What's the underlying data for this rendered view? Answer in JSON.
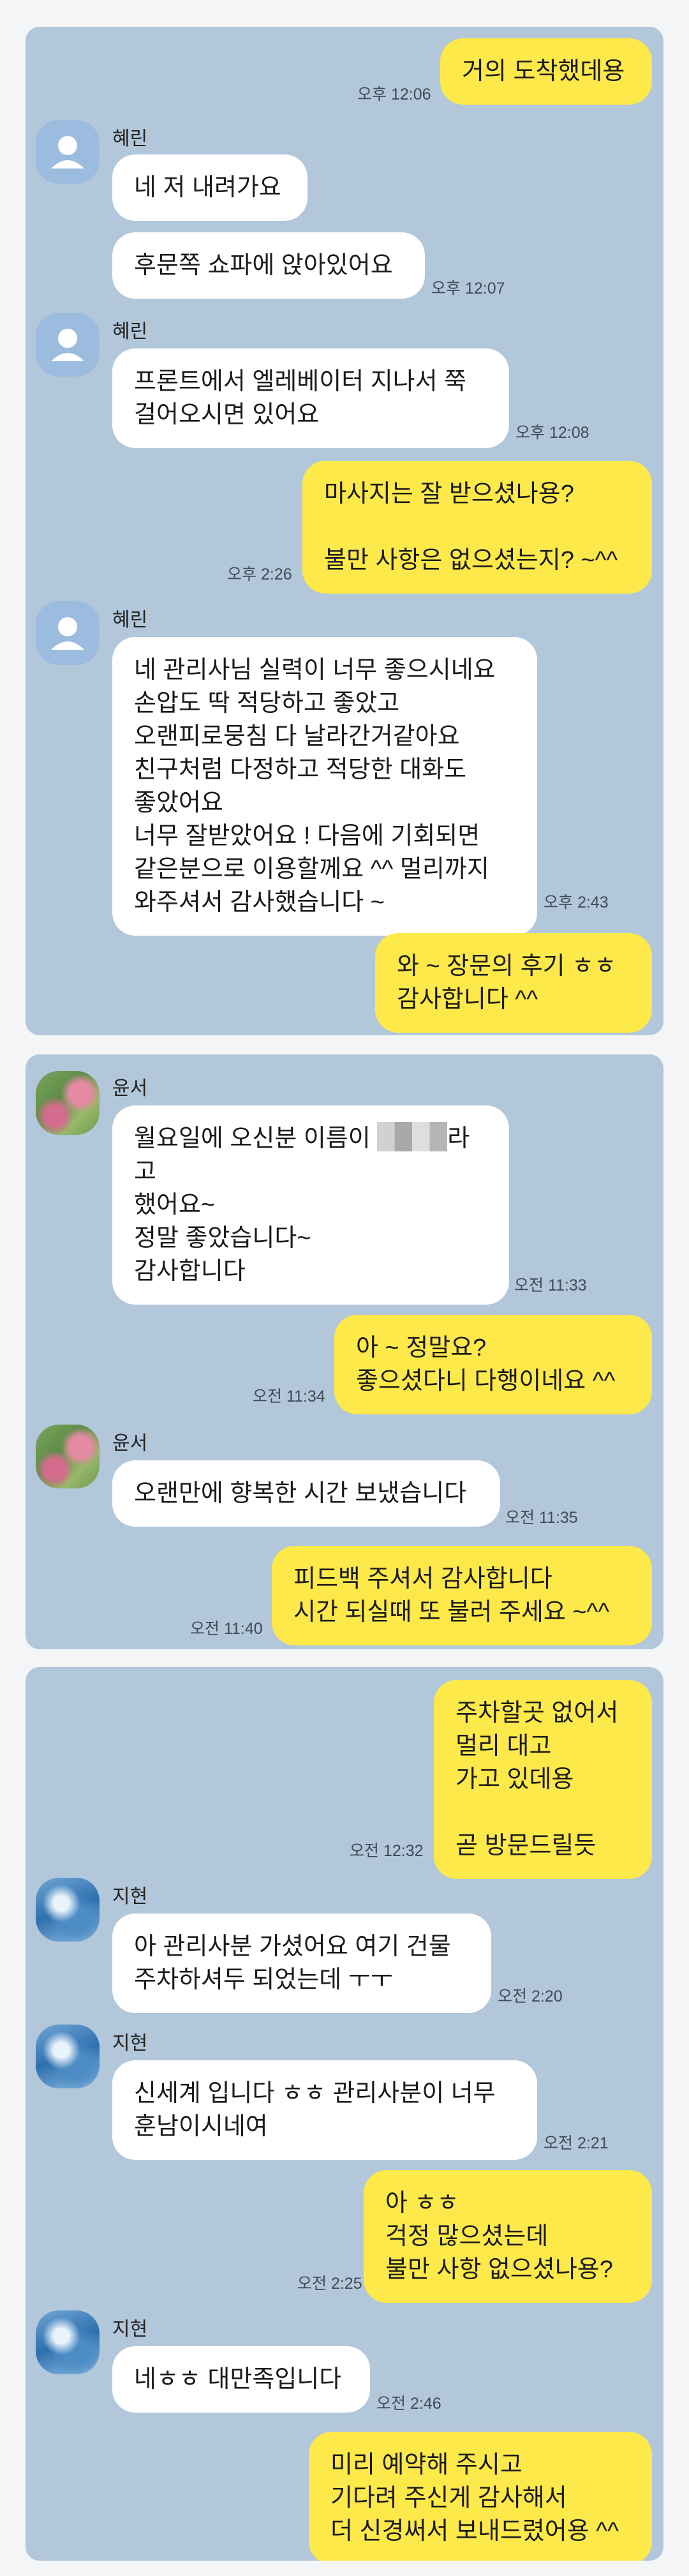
{
  "sections": [
    {
      "messages": [
        {
          "side": "out",
          "text": "거의 도착했데용",
          "time": "오후 12:06"
        },
        {
          "side": "in",
          "sender": "혜린",
          "text": "네 저 내려가요"
        },
        {
          "side": "in",
          "text": "후문쪽 쇼파에 앉아있어요",
          "time": "오후 12:07"
        },
        {
          "side": "in",
          "sender": "혜린",
          "text": "프론트에서 엘레베이터 지나서 쭉\n걸어오시면 있어요",
          "time": "오후 12:08"
        },
        {
          "side": "out",
          "text": "마사지는 잘 받으셨나용?\n\n불만 사항은 없으셨는지? ~^^",
          "time": "오후 2:26"
        },
        {
          "side": "in",
          "sender": "혜린",
          "text": "네 관리사님 실력이 너무 좋으시네요\n손압도 딱 적당하고 좋았고\n오랜피로뭉침 다 날라간거같아요\n친구처럼 다정하고 적당한 대화도\n좋았어요\n너무 잘받았어요 ! 다음에 기회되면\n같은분으로 이용할께요 ^^ 멀리까지\n와주셔서 감사했습니다 ~",
          "time": "오후 2:43"
        },
        {
          "side": "out",
          "text": "와 ~ 장문의 후기 ㅎㅎ\n감사합니다 ^^"
        }
      ]
    },
    {
      "messages": [
        {
          "side": "in",
          "sender": "윤서",
          "text_before": "월요일에 오신분 이름이 ",
          "text_after": "라고\n했어요~\n정말 좋았습니다~\n감사합니다",
          "time": "오전 11:33"
        },
        {
          "side": "out",
          "text": "아 ~ 정말요?\n좋으셨다니 다행이네요 ^^",
          "time": "오전 11:34"
        },
        {
          "side": "in",
          "sender": "윤서",
          "text": "오랜만에 향복한 시간 보냈습니다",
          "time": "오전 11:35"
        },
        {
          "side": "out",
          "text": "피드백 주셔서 감사합니다\n시간 되실때 또 불러 주세요 ~^^",
          "time": "오전 11:40"
        }
      ]
    },
    {
      "messages": [
        {
          "side": "out",
          "text": "주차할곳 없어서\n멀리 대고\n가고 있데용\n\n곧 방문드릴듯",
          "time": "오전 12:32"
        },
        {
          "side": "in",
          "sender": "지현",
          "text": "아 관리사분 가셨어요 여기 건물\n주차하셔두 되었는데 ㅜㅜ",
          "time": "오전 2:20"
        },
        {
          "side": "in",
          "sender": "지현",
          "text": "신세계 입니다 ㅎㅎ 관리사분이 너무\n훈남이시네여",
          "time": "오전 2:21"
        },
        {
          "side": "out",
          "text": "아 ㅎㅎ\n걱정 많으셨는데\n불만 사항 없으셨나용?",
          "time": "오전 2:25"
        },
        {
          "side": "in",
          "sender": "지현",
          "text": "네ㅎㅎ 대만족입니다",
          "time": "오전 2:46"
        },
        {
          "side": "out",
          "text": "미리 예약해 주시고\n기다려 주신게 감사해서\n더 신경써서 보내드렸어용 ^^"
        }
      ]
    }
  ]
}
